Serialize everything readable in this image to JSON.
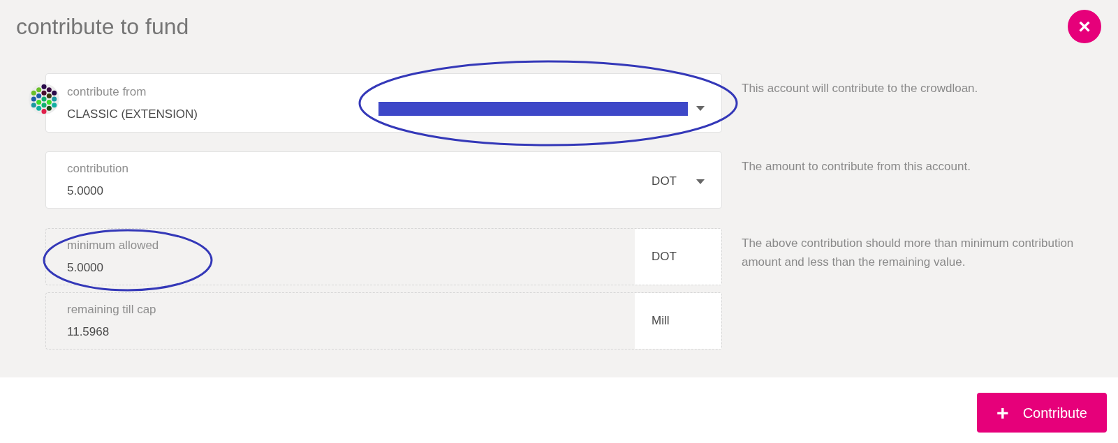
{
  "title": "contribute to fund",
  "fields": [
    {
      "kind": "account",
      "label": "contribute from",
      "value": "CLASSIC (EXTENSION)",
      "help": "This account will contribute to the crowdloan."
    },
    {
      "kind": "amount",
      "label": "contribution",
      "value": "5.0000",
      "unit": "DOT",
      "help": "The amount to contribute from this account."
    },
    {
      "kind": "readonly",
      "label": "minimum allowed",
      "value": "5.0000",
      "unit": "DOT",
      "help": "The above contribution should more than minimum contribution amount and less than the remaining value."
    },
    {
      "kind": "readonly",
      "label": "remaining till cap",
      "value": "11.5968",
      "unit": "Mill"
    }
  ],
  "close_button": "×",
  "action_button": {
    "icon": "+",
    "label": "Contribute"
  }
}
